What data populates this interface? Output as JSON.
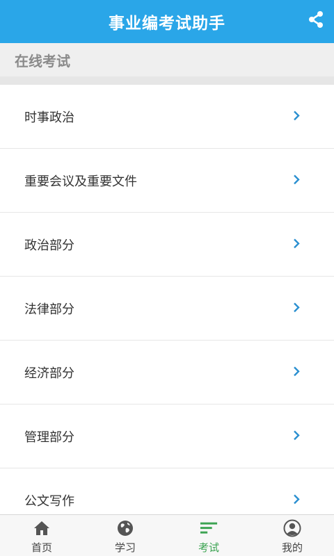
{
  "app_bar": {
    "title": "事业编考试助手",
    "share_icon": "share-icon"
  },
  "section": {
    "title": "在线考试"
  },
  "list": {
    "items": [
      {
        "label": "时事政治"
      },
      {
        "label": "重要会议及重要文件"
      },
      {
        "label": "政治部分"
      },
      {
        "label": "法律部分"
      },
      {
        "label": "经济部分"
      },
      {
        "label": "管理部分"
      },
      {
        "label": "公文写作"
      }
    ],
    "chevron_icon": "chevron-right-icon"
  },
  "bottom_nav": {
    "items": [
      {
        "label": "首页",
        "icon": "home-icon"
      },
      {
        "label": "学习",
        "icon": "globe-icon"
      },
      {
        "label": "考试",
        "icon": "list-icon",
        "active": true
      },
      {
        "label": "我的",
        "icon": "user-icon"
      }
    ]
  },
  "colors": {
    "primary": "#2aa6e8",
    "active_nav": "#3ca352",
    "chevron": "#2a8fd0"
  }
}
